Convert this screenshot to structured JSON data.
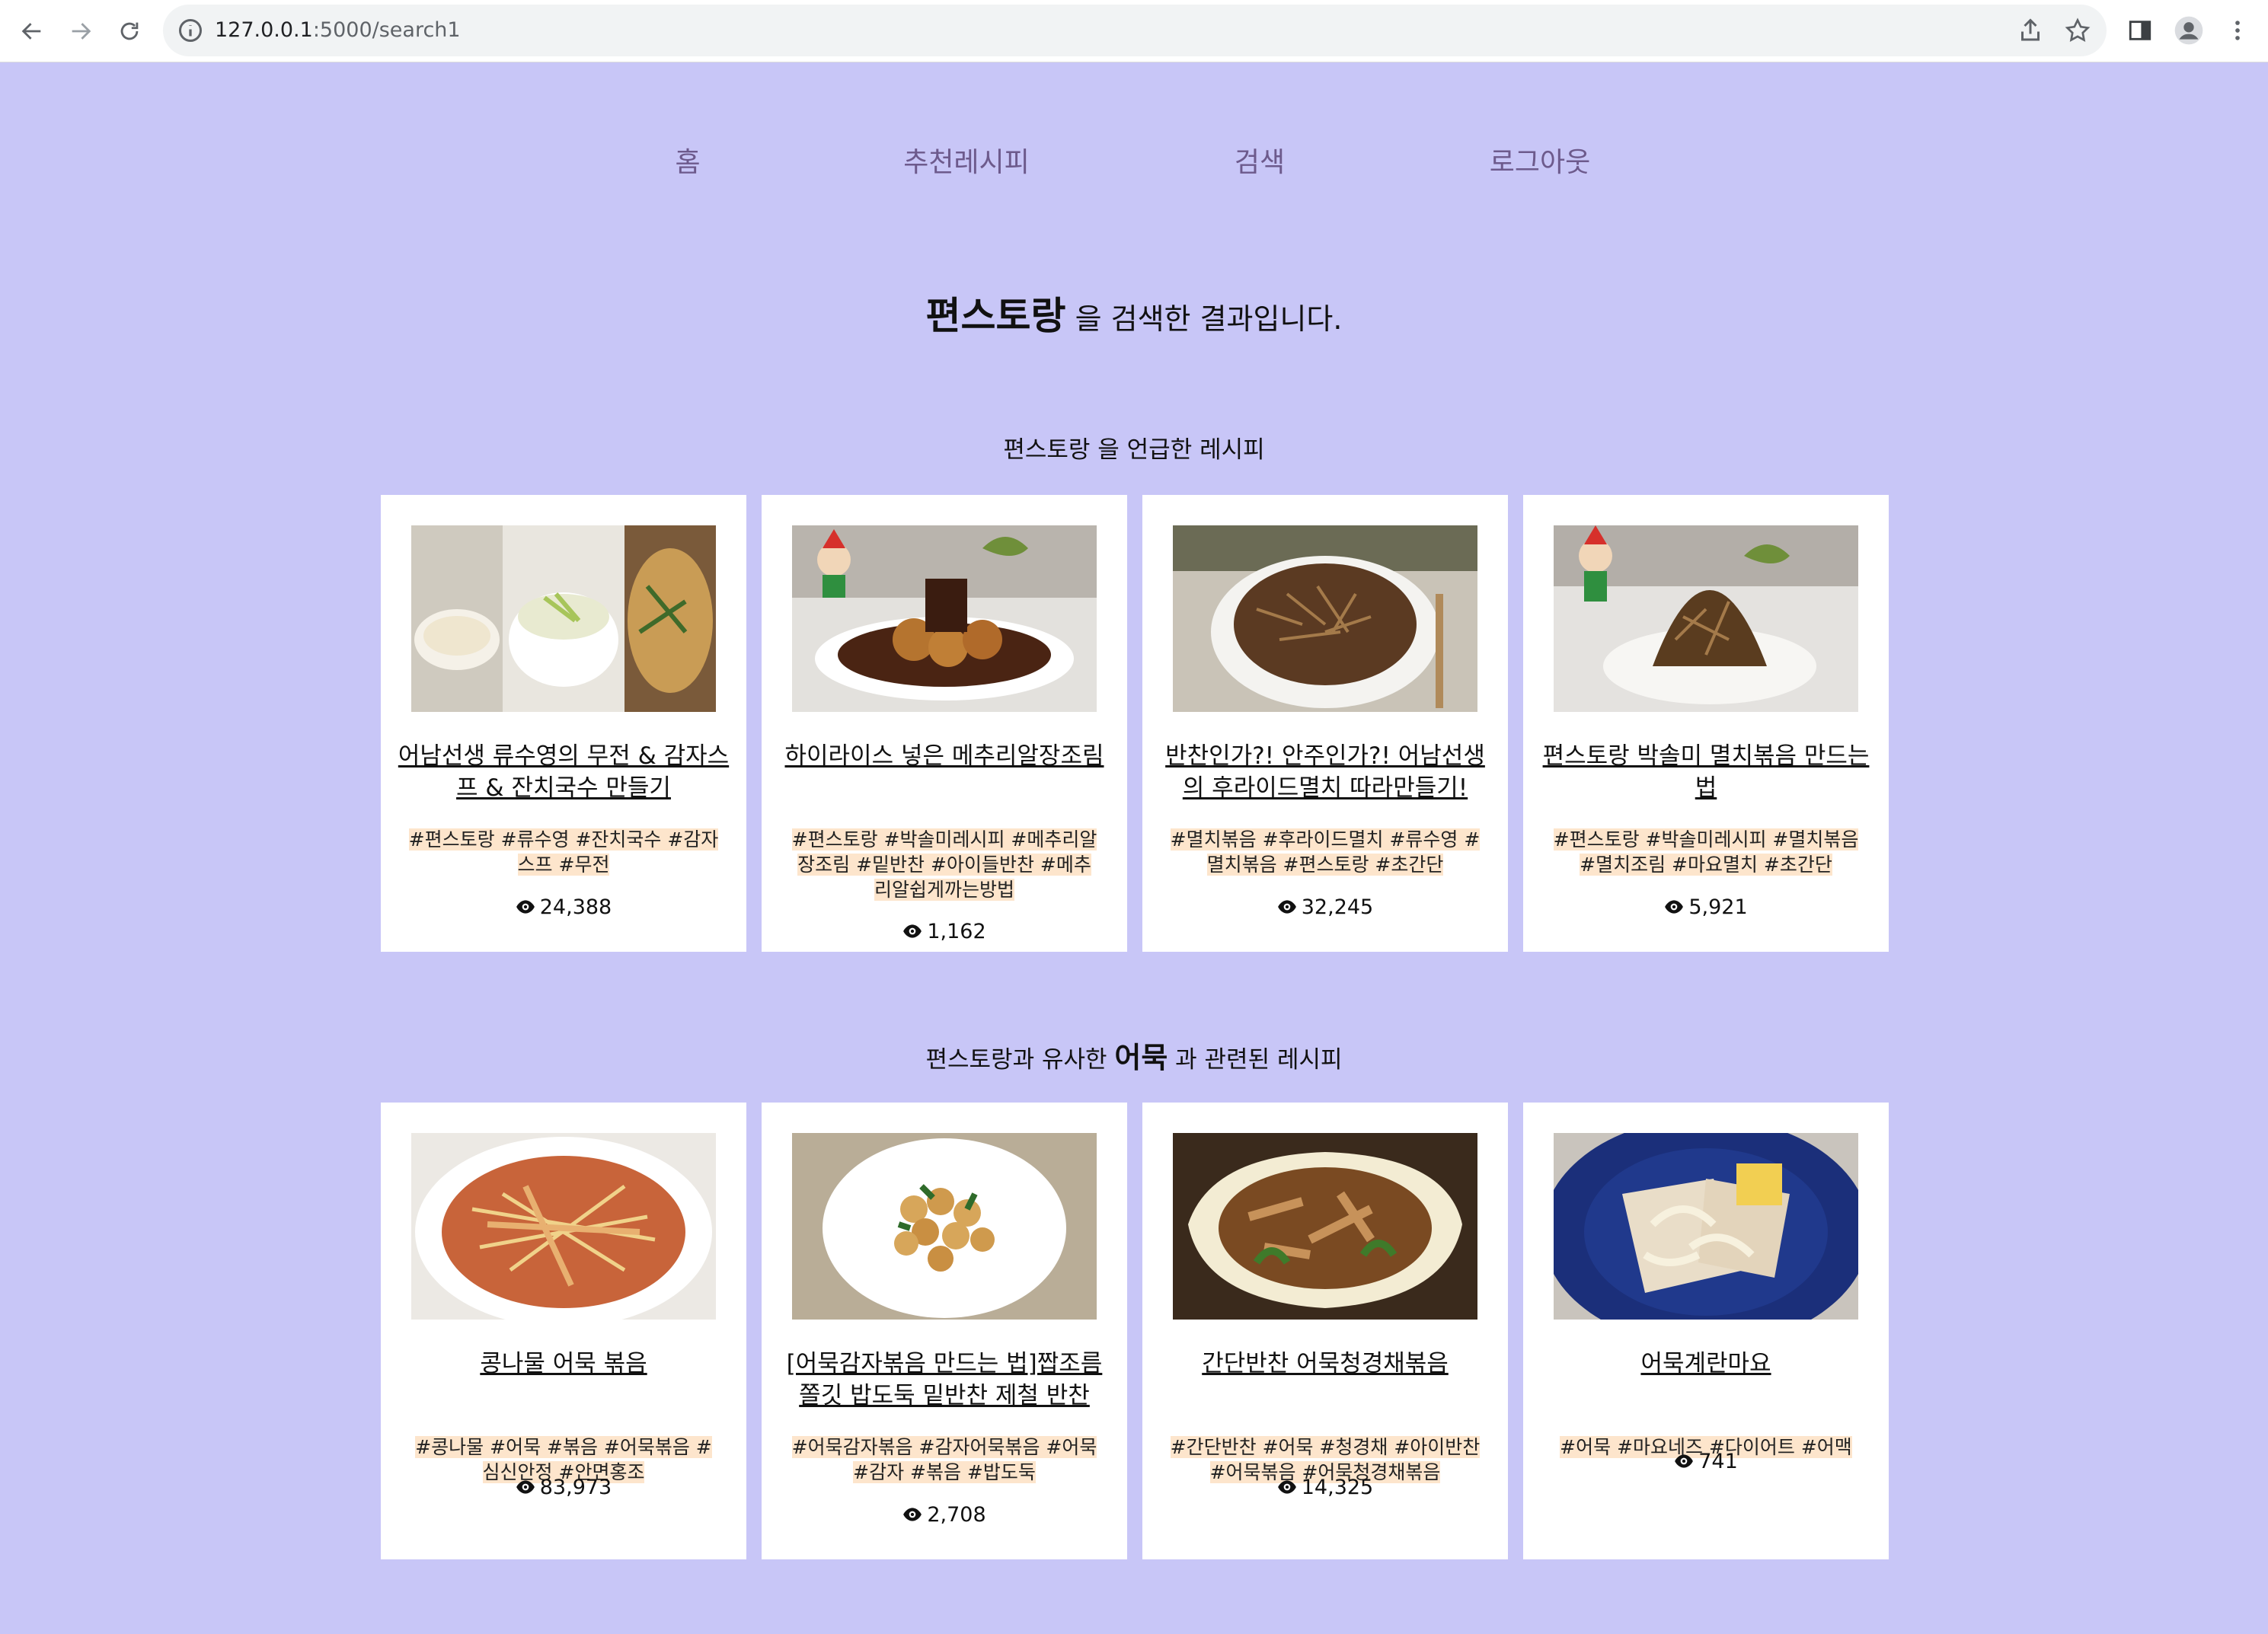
{
  "browser": {
    "url_host": "127.0.0.1",
    "url_path": ":5000/search1"
  },
  "nav": {
    "items": [
      "홈",
      "추천레시피",
      "검색",
      "로그아웃"
    ]
  },
  "result": {
    "keyword": "편스토랑",
    "suffix": " 을 검색한 결과입니다."
  },
  "section1": {
    "title": "편스토랑 을 언급한 레시피",
    "cards": [
      {
        "title": "어남선생 류수영의 무전 & 감자스프 & 잔치국수 만들기",
        "tags": "#편스토랑 #류수영 #잔치국수 #감자스프 #무전",
        "views": "24,388"
      },
      {
        "title": "하이라이스 넣은 메추리알장조림",
        "tags": "#편스토랑 #박솔미레시피 #메추리알장조림 #밑반찬 #아이들반찬 #메추리알쉽게까는방법",
        "views": "1,162"
      },
      {
        "title": "반찬인가?! 안주인가?! 어남선생의 후라이드멸치 따라만들기!",
        "tags": "#멸치볶음 #후라이드멸치 #류수영 #멸치볶음 #편스토랑 #초간단",
        "views": "32,245"
      },
      {
        "title": "편스토랑 박솔미 멸치볶음 만드는 법",
        "tags": "#편스토랑 #박솔미레시피 #멸치볶음 #멸치조림 #마요멸치 #초간단",
        "views": "5,921"
      }
    ]
  },
  "section2": {
    "title_before": "편스토랑과 유사한 ",
    "keyword": "어묵",
    "title_after": " 과 관련된 레시피",
    "cards": [
      {
        "title": "콩나물 어묵 볶음",
        "tags": "#콩나물 #어묵 #볶음 #어묵볶음 #심신안정 #안면홍조",
        "views": "83,973"
      },
      {
        "title": "[어묵감자볶음 만드는 법]짭조름 쫄깃 밥도둑 밑반찬 제철 반찬",
        "tags": "#어묵감자볶음 #감자어묵볶음 #어묵 #감자 #볶음 #밥도둑",
        "views": "2,708"
      },
      {
        "title": "간단반찬 어묵청경채볶음",
        "tags": "#간단반찬 #어묵 #청경채 #아이반찬 #어묵볶음 #어묵청경채볶음",
        "views": "14,325"
      },
      {
        "title": "어묵계란마요",
        "tags": "#어묵 #마요네즈 #다이어트 #어맥",
        "views": "741"
      }
    ]
  },
  "colors": {
    "page_bg": "#c8c6f7",
    "nav_text": "#6d5a8c",
    "tag_highlight": "#fde5cc"
  }
}
